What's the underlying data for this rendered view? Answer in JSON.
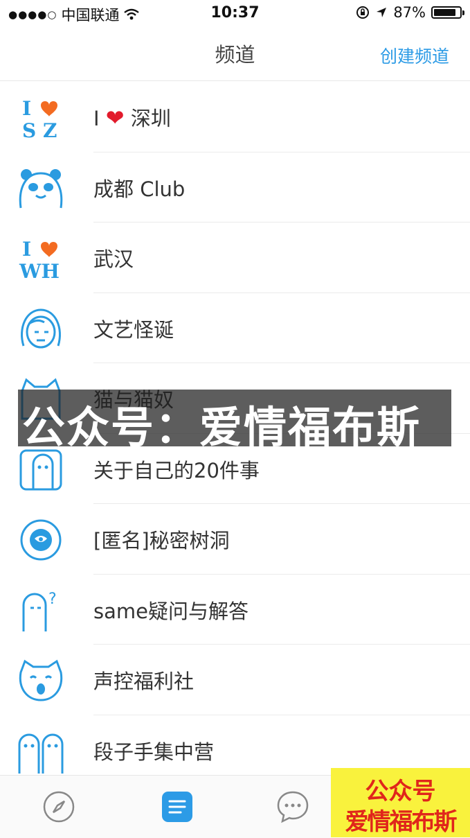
{
  "status_bar": {
    "signal_dots": "●●●●○",
    "carrier": "中国联通",
    "time": "10:37",
    "battery_text": "87%",
    "battery_level": 0.87
  },
  "nav": {
    "title": "频道",
    "action": "创建频道"
  },
  "channels": [
    {
      "icon": "i-love-sz-icon",
      "icon_text": [
        "I",
        "S Z"
      ],
      "label_pre": "I",
      "label_heart": "❤️",
      "label": "深圳"
    },
    {
      "icon": "panda-icon",
      "label": "成都  Club"
    },
    {
      "icon": "i-love-wh-icon",
      "icon_text": [
        "I",
        "WH"
      ],
      "label": "武汉"
    },
    {
      "icon": "grumpy-face-icon",
      "label": "文艺怪诞"
    },
    {
      "icon": "cat-icon",
      "label": "猫与猫奴"
    },
    {
      "icon": "peek-character-icon",
      "label": "关于自己的20件事"
    },
    {
      "icon": "anonymous-mask-icon",
      "label": "[匿名]秘密树洞"
    },
    {
      "icon": "question-ghost-icon",
      "label": "same疑问与解答"
    },
    {
      "icon": "singing-cat-icon",
      "label": "声控福利社"
    },
    {
      "icon": "two-ghosts-icon",
      "label": "段子手集中营"
    }
  ],
  "watermark": {
    "banner_text": "公众号：爱情福布斯",
    "stamp_line1": "公众号",
    "stamp_line2": "爱情福布斯"
  },
  "tabbar": {
    "tabs": [
      {
        "icon": "compass-icon",
        "active": false
      },
      {
        "icon": "channel-list-icon",
        "active": true
      },
      {
        "icon": "chat-bubble-icon",
        "active": false
      }
    ]
  },
  "colors": {
    "accent": "#2c9be6",
    "icon_blue": "#2a9be0",
    "heart_orange": "#f36b21"
  }
}
